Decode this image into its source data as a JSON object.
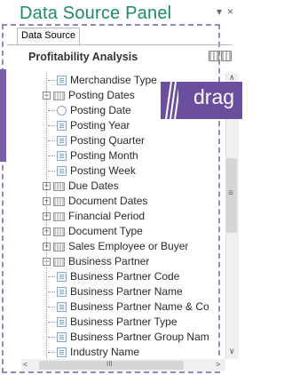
{
  "panel": {
    "title": "Data Source Panel",
    "pin_glyph": "▾",
    "close_glyph": "×"
  },
  "tab": {
    "label": "Data Source"
  },
  "header": {
    "title": "Profitability Analysis"
  },
  "tree": {
    "items": [
      {
        "label": "Merchandise Type",
        "icon": "field-icon",
        "level": 2
      },
      {
        "label": "Posting Dates",
        "icon": "folder-icon",
        "level": 1,
        "expander": "−"
      },
      {
        "label": "Posting Date",
        "icon": "clock-icon",
        "level": 2
      },
      {
        "label": "Posting Year",
        "icon": "field-icon",
        "level": 2
      },
      {
        "label": "Posting Quarter",
        "icon": "field-icon",
        "level": 2
      },
      {
        "label": "Posting Month",
        "icon": "field-icon",
        "level": 2
      },
      {
        "label": "Posting Week",
        "icon": "field-icon",
        "level": 2
      },
      {
        "label": "Due Dates",
        "icon": "folder-icon",
        "level": 1,
        "expander": "+"
      },
      {
        "label": "Document Dates",
        "icon": "folder-icon",
        "level": 1,
        "expander": "+"
      },
      {
        "label": "Financial Period",
        "icon": "folder-icon",
        "level": 1,
        "expander": "+"
      },
      {
        "label": "Document Type",
        "icon": "folder-icon",
        "level": 1,
        "expander": "+"
      },
      {
        "label": "Sales Employee or Buyer",
        "icon": "folder-icon",
        "level": 1,
        "expander": "+"
      },
      {
        "label": "Business Partner",
        "icon": "folder-icon",
        "level": 1,
        "expander": "−"
      },
      {
        "label": "Business Partner Code",
        "icon": "field-icon",
        "level": 2
      },
      {
        "label": "Business Partner Name",
        "icon": "field-icon",
        "level": 2
      },
      {
        "label": "Business Partner Name & Co",
        "icon": "field-icon",
        "level": 2
      },
      {
        "label": "Business Partner Type",
        "icon": "field-icon",
        "level": 2
      },
      {
        "label": "Business Partner Group Nam",
        "icon": "field-icon",
        "level": 2
      },
      {
        "label": "Industry Name",
        "icon": "field-icon",
        "level": 2
      }
    ]
  },
  "scroll": {
    "up": "∧",
    "down": "∨",
    "left": "<",
    "right": ">",
    "grip_v": "≡",
    "grip_h": "III"
  },
  "overlay": {
    "drag_label": "drag"
  },
  "colors": {
    "title": "#1f8b60",
    "accent": "#6b4f9e",
    "dashed": "#9a86c3"
  }
}
